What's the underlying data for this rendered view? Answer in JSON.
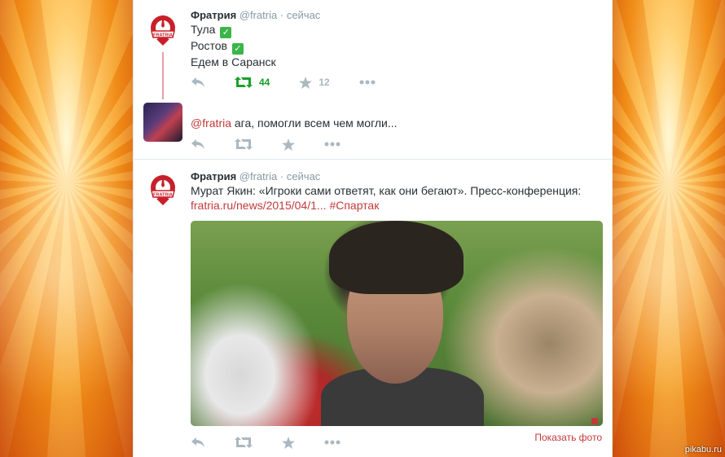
{
  "background": {
    "watermark": "pikabu.ru"
  },
  "tweets": [
    {
      "author": "Фратрия",
      "handle": "@fratria",
      "time": "сейчас",
      "lines": [
        "Тула",
        "Ростов",
        "Едем в Саранск"
      ],
      "actions": {
        "retweets": "44",
        "favorites": "12"
      }
    },
    {
      "mention": "@fratria",
      "text": "ага, помогли всем чем могли..."
    },
    {
      "author": "Фратрия",
      "handle": "@fratria",
      "time": "сейчас",
      "text": "Мурат Якин: «Игроки сами ответят, как они бегают». Пресс-конференция:",
      "link": "fratria.ru/news/2015/04/1...",
      "hashtag": "#Спартак",
      "show_photo": "Показать фото"
    }
  ],
  "colors": {
    "accent": "#c23a3a",
    "retweet_active": "#19a02a",
    "icon_gray": "#aab8c2"
  },
  "icons": [
    "reply-icon",
    "retweet-icon",
    "favorite-icon",
    "more-icon",
    "check-icon"
  ]
}
